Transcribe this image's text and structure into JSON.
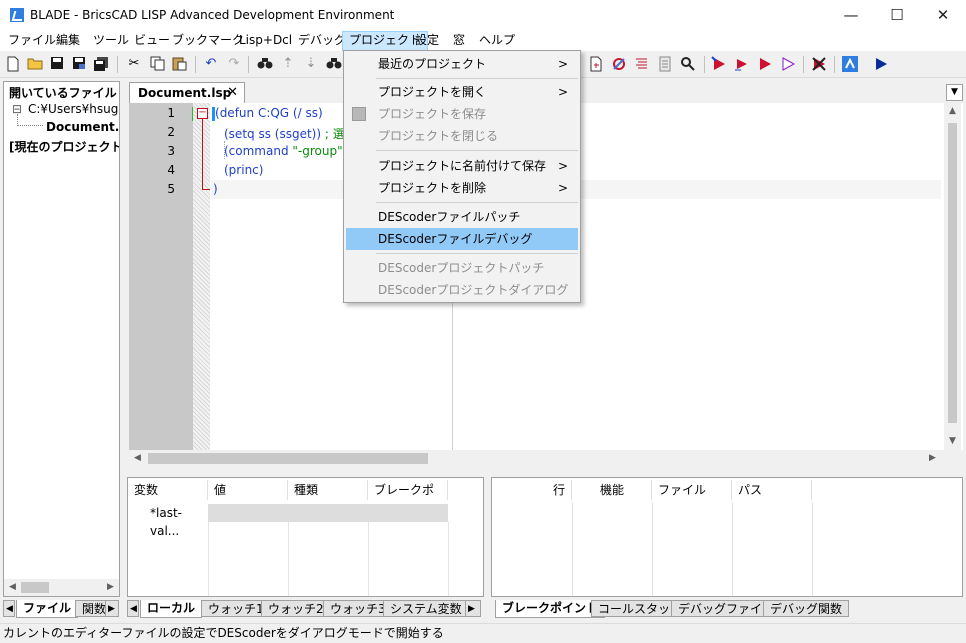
{
  "window": {
    "title": "BLADE - BricsCAD LISP Advanced Development Environment",
    "minimize_glyph": "—",
    "maximize_glyph": "☐",
    "close_glyph": "✕"
  },
  "menubar": {
    "items": [
      "ファイル",
      "編集",
      "ツール",
      "ビュー",
      "ブックマーク",
      "Lisp+Dcl",
      "デバッグ",
      "プロジェクト",
      "設定",
      "窓",
      "ヘルプ"
    ],
    "active": "プロジェクト"
  },
  "project_menu": {
    "items": [
      {
        "label": "最近のプロジェクト",
        "submenu": true,
        "enabled": true
      },
      {
        "label": "プロジェクトを開く",
        "submenu": true,
        "enabled": true
      },
      {
        "label": "プロジェクトを保存",
        "submenu": false,
        "enabled": false
      },
      {
        "label": "プロジェクトを閉じる",
        "submenu": false,
        "enabled": false
      },
      {
        "label": "プロジェクトに名前付けて保存",
        "submenu": true,
        "enabled": true
      },
      {
        "label": "プロジェクトを削除",
        "submenu": true,
        "enabled": true
      },
      {
        "label": "DEScoderファイルパッチ",
        "submenu": false,
        "enabled": true
      },
      {
        "label": "DEScoderファイルデバッグ",
        "submenu": false,
        "enabled": true,
        "highlighted": true
      },
      {
        "label": "DEScoderプロジェクトパッチ",
        "submenu": false,
        "enabled": false
      },
      {
        "label": "DEScoderプロジェクトダイアログ",
        "submenu": false,
        "enabled": false
      }
    ],
    "submenu_arrow": ">"
  },
  "left_panel": {
    "header": "開いているファイル",
    "path": "C:¥Users¥hsugiha",
    "file": "Document.lsp",
    "project": "[現在のプロジェクト]",
    "tabs": [
      "ファイル",
      "関数"
    ]
  },
  "editor": {
    "tab_label": "Document.lsp",
    "tab_close": "✕",
    "line_numbers": [
      "1",
      "2",
      "3",
      "4",
      "5"
    ],
    "lines": [
      {
        "a": "(",
        "b": "defun C:QG (/ ss)"
      },
      {
        "a": "(setq ss (ssget)) ",
        "b": "; 選択"
      },
      {
        "a": "(command ",
        "b": "\"-group\""
      },
      {
        "a": "(princ)",
        "b": ""
      },
      {
        "a": ")",
        "b": ""
      }
    ]
  },
  "locals_pane": {
    "columns": [
      "変数",
      "値",
      "種類",
      "ブレークポイ..."
    ],
    "rows": [
      [
        "*last-val...",
        "",
        "",
        ""
      ]
    ],
    "tabs": [
      "ローカル",
      "ウォッチ1",
      "ウォッチ2",
      "ウォッチ3",
      "システム変数"
    ]
  },
  "breakpoints_pane": {
    "columns": [
      "行",
      "機能",
      "ファイル",
      "パス"
    ],
    "tabs": [
      "ブレークポイント",
      "コールスタック",
      "デバッグファイル",
      "デバッグ関数"
    ]
  },
  "statusbar": {
    "text": "カレントのエディターファイルの設定でDEScoderをダイアログモードで開始する"
  },
  "colors": {
    "menu_highlight": "#91c9f7",
    "keyword_blue": "#1e3fc8",
    "comment_green": "#0a8a0a",
    "string_magenta": "#a0166e"
  }
}
